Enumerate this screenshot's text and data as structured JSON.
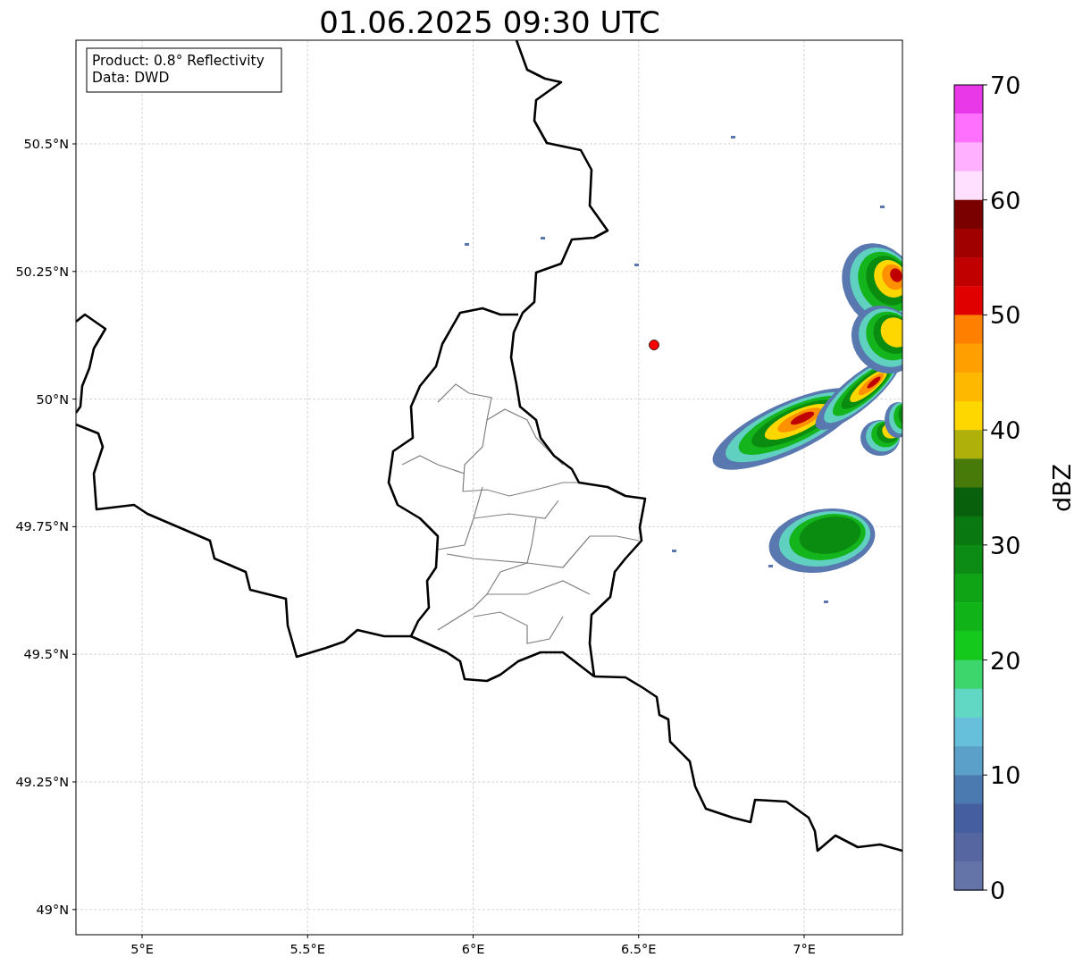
{
  "title": "01.06.2025 09:30 UTC",
  "info_box": [
    "Product: 0.8° Reflectivity",
    "Data: DWD"
  ],
  "y_axis": {
    "ticks": [
      "50.5°N",
      "50.25°N",
      "50°N",
      "49.75°N",
      "49.5°N",
      "49.25°N",
      "49°N"
    ]
  },
  "x_axis": {
    "ticks": [
      "5°E",
      "5.5°E",
      "6°E",
      "6.5°E",
      "7°E"
    ]
  },
  "colorbar": {
    "label": "dBZ",
    "ticks": [
      "70",
      "60",
      "50",
      "40",
      "30",
      "20",
      "10",
      "0"
    ],
    "bands": [
      {
        "color": "#e838e8"
      },
      {
        "color": "#ff70ff"
      },
      {
        "color": "#ffb0ff"
      },
      {
        "color": "#ffe0ff"
      },
      {
        "color": "#7a0000"
      },
      {
        "color": "#a00000"
      },
      {
        "color": "#c00000"
      },
      {
        "color": "#e00000"
      },
      {
        "color": "#ff8000"
      },
      {
        "color": "#ffa000"
      },
      {
        "color": "#ffb800"
      },
      {
        "color": "#ffd700"
      },
      {
        "color": "#b0b00a"
      },
      {
        "color": "#487a0a"
      },
      {
        "color": "#08600c"
      },
      {
        "color": "#0a7810"
      },
      {
        "color": "#0c8c14"
      },
      {
        "color": "#0ea416"
      },
      {
        "color": "#10b418"
      },
      {
        "color": "#14c81c"
      },
      {
        "color": "#3cd66c"
      },
      {
        "color": "#60d8c4"
      },
      {
        "color": "#66c0dc"
      },
      {
        "color": "#5aa0c8"
      },
      {
        "color": "#4a7ab0"
      },
      {
        "color": "#445ea0"
      },
      {
        "color": "#5666a0"
      },
      {
        "color": "#6474a8"
      }
    ]
  }
}
